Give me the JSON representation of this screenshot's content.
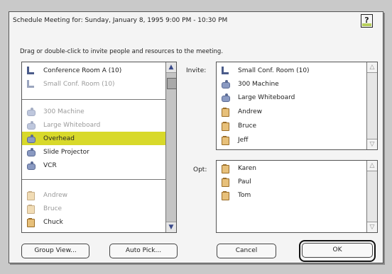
{
  "dialog": {
    "title": "Schedule Meeting for: Sunday, January 8, 1995 9:00 PM - 10:30 PM",
    "instructions": "Drag or double-click to invite people and resources to the meeting.",
    "help_icon": "question-icon"
  },
  "available": {
    "rooms": [
      {
        "label": "Conference Room A (10)",
        "icon": "room-icon",
        "dim": false
      },
      {
        "label": "Small Conf. Room (10)",
        "icon": "room-icon",
        "dim": true
      }
    ],
    "equipment": [
      {
        "label": "300 Machine",
        "icon": "equipment-icon",
        "dim": true
      },
      {
        "label": "Large Whiteboard",
        "icon": "equipment-icon",
        "dim": true
      },
      {
        "label": "Overhead",
        "icon": "equipment-icon",
        "dim": false,
        "selected": true
      },
      {
        "label": "Slide Projector",
        "icon": "equipment-icon",
        "dim": false
      },
      {
        "label": "VCR",
        "icon": "equipment-icon",
        "dim": false
      }
    ],
    "people": [
      {
        "label": "Andrew",
        "icon": "person-icon",
        "dim": true
      },
      {
        "label": "Bruce",
        "icon": "person-icon",
        "dim": true
      },
      {
        "label": "Chuck",
        "icon": "person-icon",
        "dim": false
      }
    ]
  },
  "invite": {
    "label": "Invite:",
    "items": [
      {
        "label": "Small Conf. Room (10)",
        "icon": "room-icon"
      },
      {
        "label": "300 Machine",
        "icon": "equipment-icon"
      },
      {
        "label": "Large Whiteboard",
        "icon": "equipment-icon"
      },
      {
        "label": "Andrew",
        "icon": "person-icon"
      },
      {
        "label": "Bruce",
        "icon": "person-icon"
      },
      {
        "label": "Jeff",
        "icon": "person-icon"
      }
    ]
  },
  "optional": {
    "label": "Opt:",
    "items": [
      {
        "label": "Karen",
        "icon": "person-icon"
      },
      {
        "label": "Paul",
        "icon": "person-icon"
      },
      {
        "label": "Tom",
        "icon": "person-icon"
      }
    ]
  },
  "buttons": {
    "group_view": "Group View...",
    "auto_pick": "Auto Pick...",
    "cancel": "Cancel",
    "ok": "OK"
  },
  "colors": {
    "selection": "#d8d92a",
    "icon_blue": "#4b5c8a",
    "icon_folder": "#e7c07a"
  }
}
